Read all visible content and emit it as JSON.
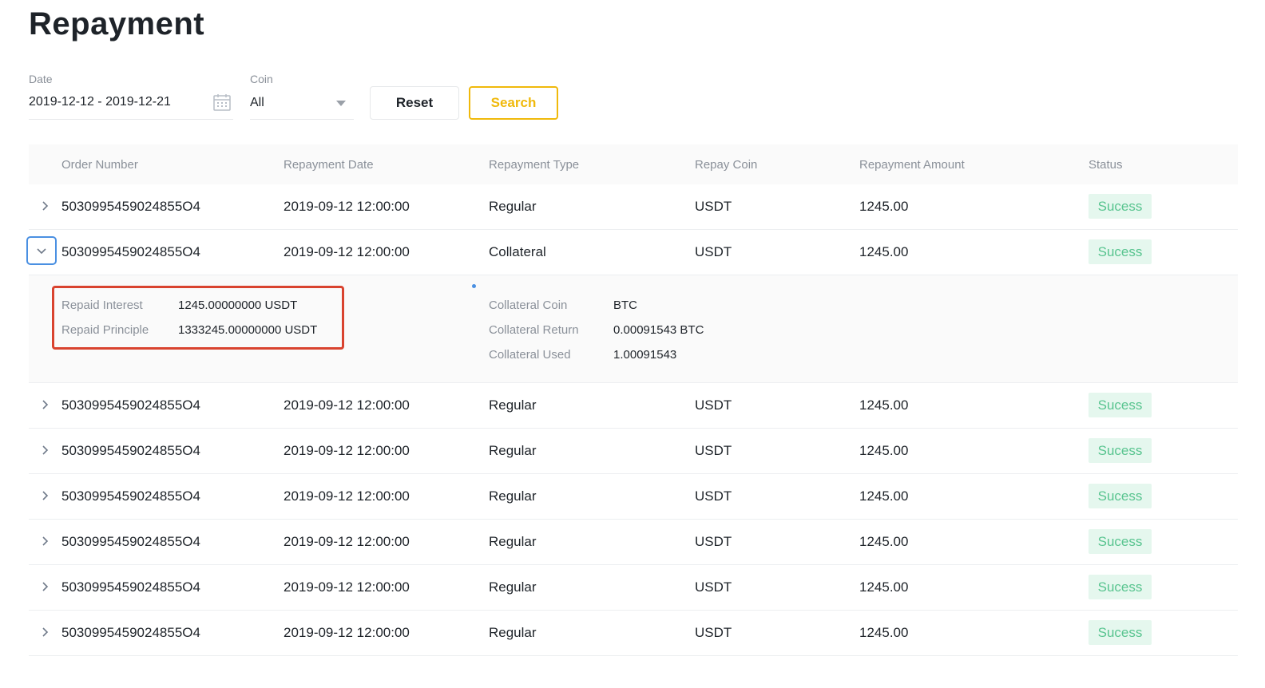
{
  "page": {
    "title": "Repayment"
  },
  "filters": {
    "date_label": "Date",
    "date_value": "2019-12-12 - 2019-12-21",
    "coin_label": "Coin",
    "coin_value": "All",
    "reset_label": "Reset",
    "search_label": "Search"
  },
  "table": {
    "columns": [
      "Order Number",
      "Repayment Date",
      "Repayment Type",
      "Repay Coin",
      "Repayment Amount",
      "Status"
    ],
    "rows": [
      {
        "order": "5030995459024855O4",
        "date": "2019-09-12  12:00:00",
        "type": "Regular",
        "coin": "USDT",
        "amount": "1245.00",
        "status": "Sucess"
      },
      {
        "order": "5030995459024855O4",
        "date": "2019-09-12  12:00:00",
        "type": "Collateral",
        "coin": "USDT",
        "amount": "1245.00",
        "status": "Sucess"
      },
      {
        "order": "5030995459024855O4",
        "date": "2019-09-12  12:00:00",
        "type": "Regular",
        "coin": "USDT",
        "amount": "1245.00",
        "status": "Sucess"
      },
      {
        "order": "5030995459024855O4",
        "date": "2019-09-12  12:00:00",
        "type": "Regular",
        "coin": "USDT",
        "amount": "1245.00",
        "status": "Sucess"
      },
      {
        "order": "5030995459024855O4",
        "date": "2019-09-12  12:00:00",
        "type": "Regular",
        "coin": "USDT",
        "amount": "1245.00",
        "status": "Sucess"
      },
      {
        "order": "5030995459024855O4",
        "date": "2019-09-12  12:00:00",
        "type": "Regular",
        "coin": "USDT",
        "amount": "1245.00",
        "status": "Sucess"
      },
      {
        "order": "5030995459024855O4",
        "date": "2019-09-12  12:00:00",
        "type": "Regular",
        "coin": "USDT",
        "amount": "1245.00",
        "status": "Sucess"
      },
      {
        "order": "5030995459024855O4",
        "date": "2019-09-12  12:00:00",
        "type": "Regular",
        "coin": "USDT",
        "amount": "1245.00",
        "status": "Sucess"
      }
    ],
    "expanded_row_index": 1,
    "detail": {
      "repaid_interest_label": "Repaid Interest",
      "repaid_interest_value": "1245.00000000 USDT",
      "repaid_principle_label": "Repaid Principle",
      "repaid_principle_value": "1333245.00000000 USDT",
      "collateral_coin_label": "Collateral Coin",
      "collateral_coin_value": "BTC",
      "collateral_return_label": "Collateral Return",
      "collateral_return_value": "0.00091543 BTC",
      "collateral_used_label": "Collateral Used",
      "collateral_used_value": "1.00091543"
    }
  },
  "colors": {
    "accent": "#f0b90b",
    "success_bg": "#e5f7ee",
    "success_text": "#58c48f",
    "highlight_border": "#d9432f",
    "focus_border": "#4a90e2"
  },
  "icons": {
    "calendar": "calendar-icon",
    "dropdown": "caret-down-icon",
    "row_collapsed": "chevron-right-icon",
    "row_expanded": "chevron-down-icon"
  }
}
